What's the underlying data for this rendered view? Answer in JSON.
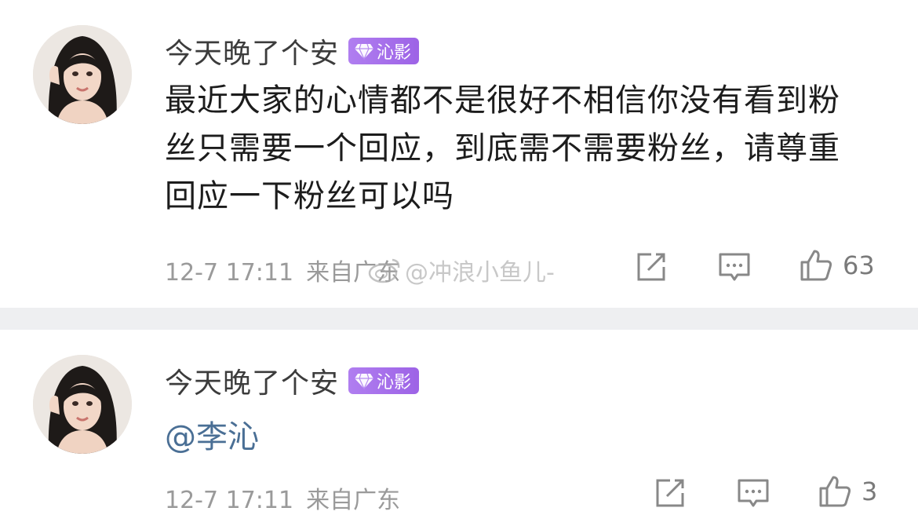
{
  "comments": [
    {
      "username": "今天晚了个安",
      "badge": "沁影",
      "text": "最近大家的心情都不是很好不相信你没有看到粉丝只需要一个回应，到底需不需要粉丝，请尊重回应一下粉丝可以吗",
      "date_time": "12-7 17:11",
      "location": "来自广东",
      "likes": "63"
    },
    {
      "username": "今天晚了个安",
      "badge": "沁影",
      "text": "@李沁",
      "date_time": "12-7 17:11",
      "location": "来自广东",
      "likes": "3"
    }
  ],
  "watermark": "@冲浪小鱼儿-",
  "icons": {
    "share": "share-icon",
    "comment": "comment-icon",
    "like": "thumbs-up-icon",
    "badge": "diamond-icon",
    "watermark": "weibo-logo-icon"
  },
  "colors": {
    "badge": "#a46dea",
    "mention": "#4a6f95",
    "meta": "#9a9a9a",
    "divider": "#eeeff1"
  }
}
